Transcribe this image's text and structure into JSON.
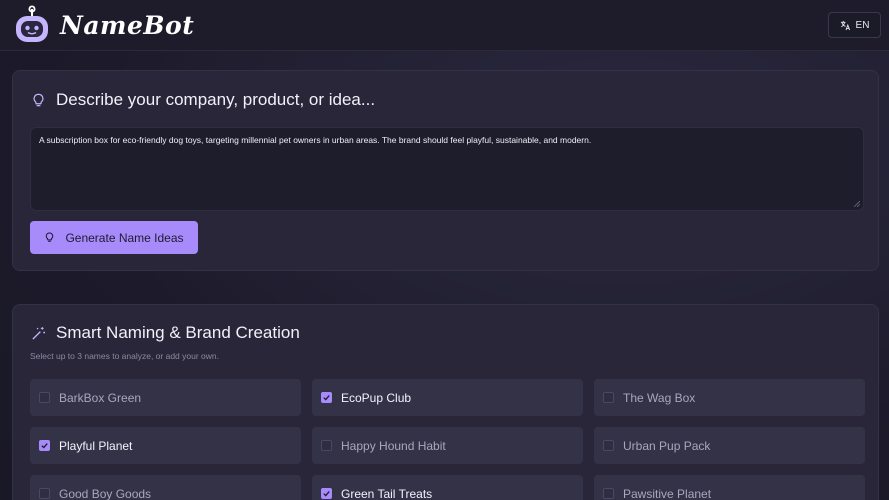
{
  "app": {
    "name": "NameBot"
  },
  "header": {
    "language_label": "EN"
  },
  "describe": {
    "title": "Describe your company, product, or idea...",
    "input_value": "A subscription box for eco-friendly dog toys, targeting millennial pet owners in urban areas. The brand should feel playful, sustainable, and modern.",
    "generate_label": "Generate Name Ideas"
  },
  "naming": {
    "title": "Smart Naming & Brand Creation",
    "subtitle": "Select up to 3 names to analyze, or add your own.",
    "options": [
      {
        "label": "BarkBox Green",
        "checked": false
      },
      {
        "label": "EcoPup Club",
        "checked": true
      },
      {
        "label": "The Wag Box",
        "checked": false
      },
      {
        "label": "Playful Planet",
        "checked": true
      },
      {
        "label": "Happy Hound Habit",
        "checked": false
      },
      {
        "label": "Urban Pup Pack",
        "checked": false
      },
      {
        "label": "Good Boy Goods",
        "checked": false
      },
      {
        "label": "Green Tail Treats",
        "checked": true
      },
      {
        "label": "Pawsitive Planet",
        "checked": false
      }
    ]
  },
  "colors": {
    "accent": "#a78bfa",
    "background": "#1d1b2b",
    "card": "#282638",
    "option": "#343247"
  }
}
